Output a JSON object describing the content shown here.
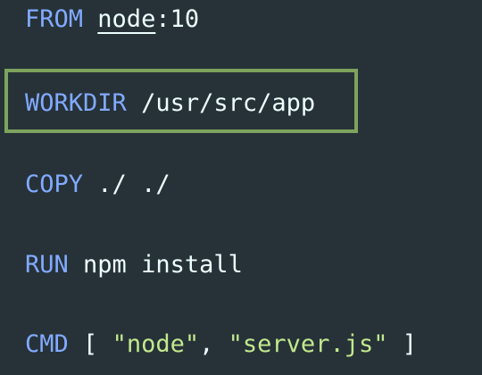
{
  "lines": [
    {
      "keyword": "FROM",
      "image": "node",
      "sep": ":",
      "tag": "10"
    },
    {
      "keyword": "WORKDIR",
      "path": "/usr/src/app"
    },
    {
      "keyword": "COPY",
      "src": "./",
      "dst": "./"
    },
    {
      "keyword": "RUN",
      "cmd": "npm install"
    },
    {
      "keyword": "CMD",
      "open": "[",
      "arg1": "\"node\"",
      "comma": ",",
      "arg2": "\"server.js\"",
      "close": "]"
    }
  ],
  "colors": {
    "background": "#263238",
    "keyword": "#82aaff",
    "string": "#c3e88d",
    "text": "#eeffff",
    "highlight_border": "#7ea35e"
  }
}
